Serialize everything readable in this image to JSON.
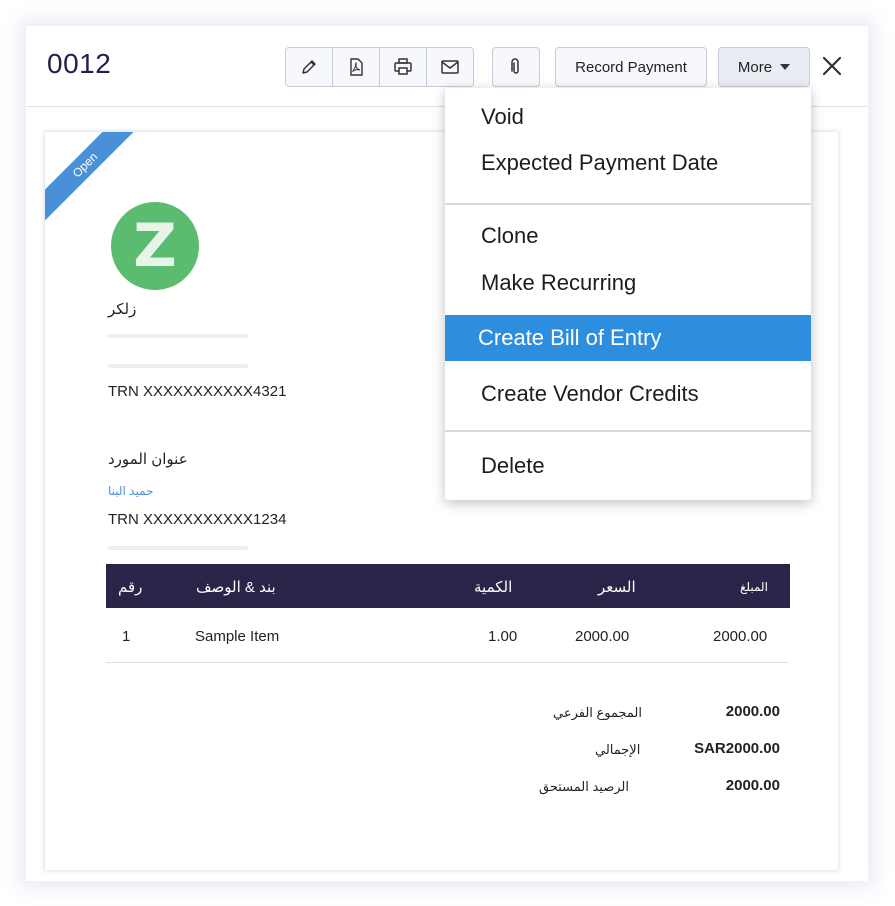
{
  "header": {
    "bill_number": "0012",
    "record_payment_label": "Record Payment",
    "more_label": "More"
  },
  "icons": [
    "edit-icon",
    "pdf-icon",
    "print-icon",
    "mail-icon",
    "attach-icon",
    "close-icon"
  ],
  "document": {
    "status_ribbon": "Open",
    "logo_letter": "Z",
    "company_name": "زلكر",
    "company_trn": "TRN XXXXXXXXXXX4321",
    "vendor_address_label": "عنوان المورد",
    "vendor_name": "حميد البنا",
    "vendor_trn": "TRN XXXXXXXXXXX1234",
    "table": {
      "headers": [
        "رقم",
        "بند & الوصف",
        "الكمية",
        "السعر",
        "المبلغ"
      ],
      "rows": [
        {
          "num": "1",
          "item": "Sample Item",
          "qty": "1.00",
          "rate": "2000.00",
          "amount": "2000.00"
        }
      ]
    },
    "totals": {
      "subtotal_label": "المجموع الفرعي",
      "subtotal_value": "2000.00",
      "total_label": "الإجمالي",
      "total_value": "SAR2000.00",
      "balance_label": "الرصيد المستحق",
      "balance_value": "2000.00"
    }
  },
  "more_menu": {
    "items": [
      {
        "label": "Void"
      },
      {
        "label": "Expected Payment Date"
      },
      {
        "label": "Clone"
      },
      {
        "label": "Make Recurring"
      },
      {
        "label": "Create Bill of Entry",
        "active": true
      },
      {
        "label": "Create Vendor Credits"
      },
      {
        "label": "Delete"
      }
    ]
  },
  "colors": {
    "ribbon": "#4a90d9",
    "logo": "#5bbb6e",
    "table_header": "#2b2449",
    "menu_active": "#2e8ede",
    "vendor_link": "#4a90d9"
  }
}
